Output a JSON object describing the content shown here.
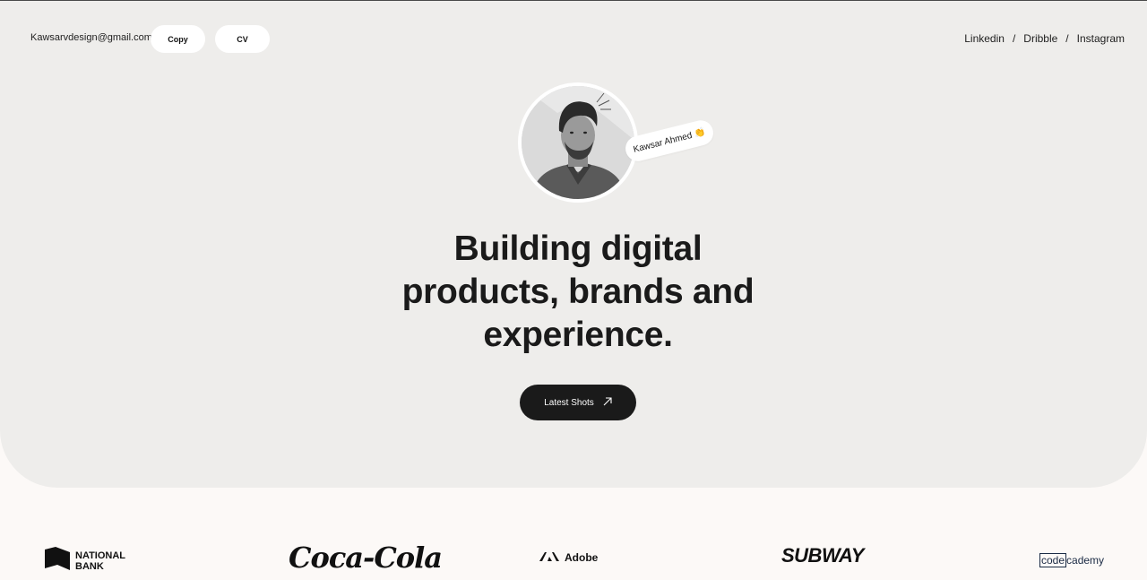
{
  "header": {
    "email": "Kawsarvdesign@gmail.com",
    "copy_label": "Copy",
    "cv_label": "CV",
    "social": [
      {
        "label": "Linkedin"
      },
      {
        "label": "Dribble"
      },
      {
        "label": "Instagram"
      }
    ],
    "separator": "/"
  },
  "profile": {
    "name_tag": "Kawsar Ahmed",
    "name_emoji": "👏"
  },
  "hero": {
    "headline_line1": "Building digital",
    "headline_line2": "products, brands and",
    "headline_line3": "experience.",
    "cta_label": "Latest Shots",
    "cta_icon": "↗"
  },
  "clients": {
    "national_bank_line1": "NATIONAL",
    "national_bank_line2": "BANK",
    "cocacola": "Coca-Cola",
    "adobe": "Adobe",
    "subway": "SUBWAY",
    "codecademy_box": "code",
    "codecademy_rest": "cademy"
  },
  "colors": {
    "hero_bg": "#eeedeb",
    "page_bg": "#fcf9f7",
    "dark": "#1a1a1a",
    "white": "#ffffff"
  }
}
